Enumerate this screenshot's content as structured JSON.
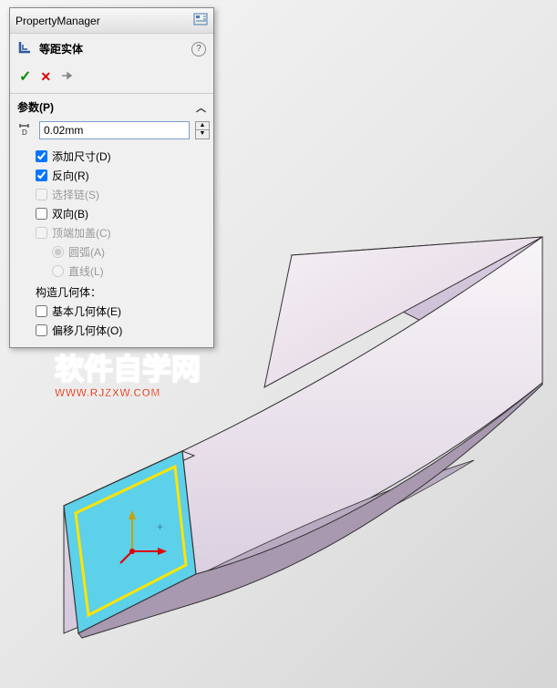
{
  "panel": {
    "title": "PropertyManager",
    "feature_name": "等距实体",
    "help_symbol": "?"
  },
  "actions": {
    "ok": "✓",
    "cancel": "✕",
    "pin": "⊸"
  },
  "parameters": {
    "section_label": "参数(P)",
    "toggle_symbol": "︿",
    "value": "0.02mm",
    "options": {
      "add_dim": "添加尺寸(D)",
      "reverse": "反向(R)",
      "select_chain": "选择链(S)",
      "bidir": "双向(B)",
      "cap_ends": "顶端加盖(C)",
      "arc": "圆弧(A)",
      "line": "直线(L)"
    },
    "checked": {
      "add_dim": true,
      "reverse": true,
      "select_chain": false,
      "bidir": false,
      "cap_ends": false,
      "arc": true,
      "line": false
    },
    "construction_label": "构造几何体：",
    "construction": {
      "base": "基本几何体(E)",
      "offset": "偏移几何体(O)"
    }
  },
  "watermark": {
    "text": "软件自学网",
    "url": "WWW.RJZXW.COM"
  }
}
